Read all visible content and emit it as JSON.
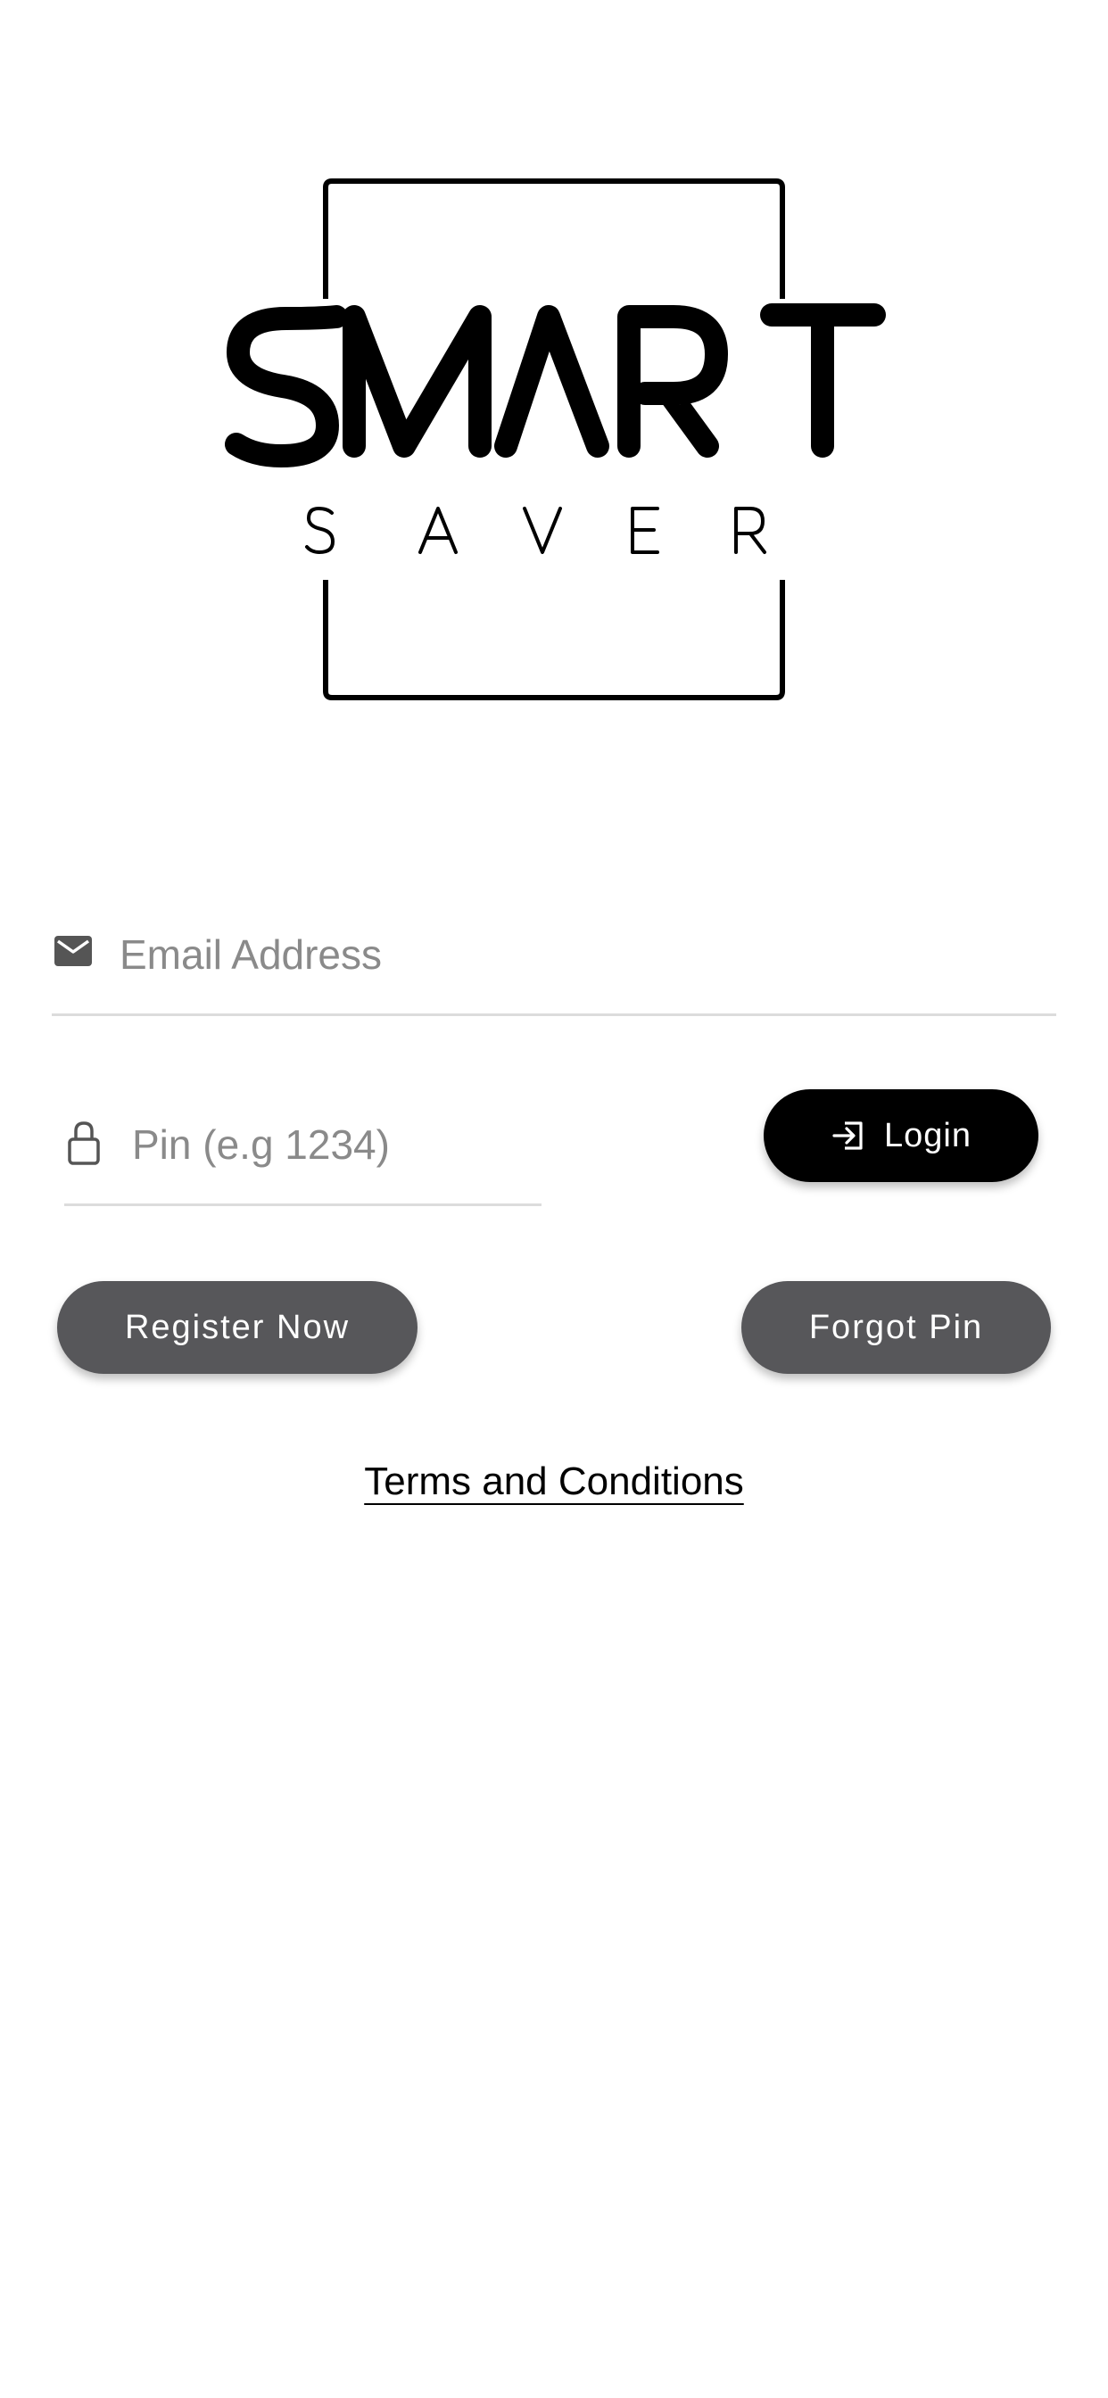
{
  "logo": {
    "line1": "SMART",
    "line2": "S A V E R"
  },
  "login_form": {
    "email_placeholder": "Email Address",
    "email_value": "",
    "email_icon": "mail-icon",
    "pin_placeholder": "Pin (e.g 1234)",
    "pin_value": "",
    "pin_icon": "lock-icon",
    "login_label": "Login",
    "login_icon": "sign-in-icon"
  },
  "actions": {
    "register_label": "Register Now",
    "forgot_label": "Forgot Pin"
  },
  "footer": {
    "terms_label": "Terms and Conditions"
  },
  "colors": {
    "primary": "#000000",
    "secondary_button": "#57575a",
    "placeholder": "#8a8a8a",
    "divider": "#dcdcdc"
  }
}
